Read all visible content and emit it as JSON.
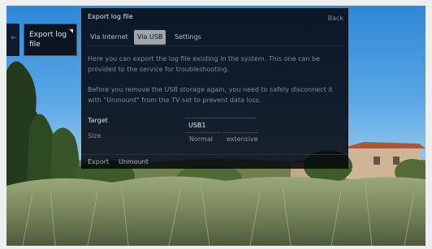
{
  "side_menu": {
    "prev_indicator": "←",
    "selected_item": {
      "label": "Export log file",
      "indicator": "◥"
    }
  },
  "panel": {
    "title": "Export log file",
    "back_label": "Back",
    "tabs": [
      {
        "label": "Via Internet",
        "active": false
      },
      {
        "label": "Via USB",
        "active": true
      },
      {
        "label": "Settings",
        "active": false
      }
    ],
    "intro_text": "Here you can export the log file existing in the system. This one can be provided to the service for troubleshooting.",
    "warning_text": "Before you remove the USB storage again, you need to safely disconnect it with \"Unmount\" from the TV set to prevent data loss.",
    "target": {
      "label": "Target",
      "value": "USB1"
    },
    "size": {
      "label": "Size",
      "options": [
        "Normal",
        "extensive"
      ]
    },
    "footer": {
      "export_label": "Export",
      "unmount_label": "Unmount"
    }
  },
  "colors": {
    "panel_bg": "#03060c",
    "active_tab": "#9ea5ad",
    "text": "#dfe3e8",
    "muted_text": "#808996"
  }
}
